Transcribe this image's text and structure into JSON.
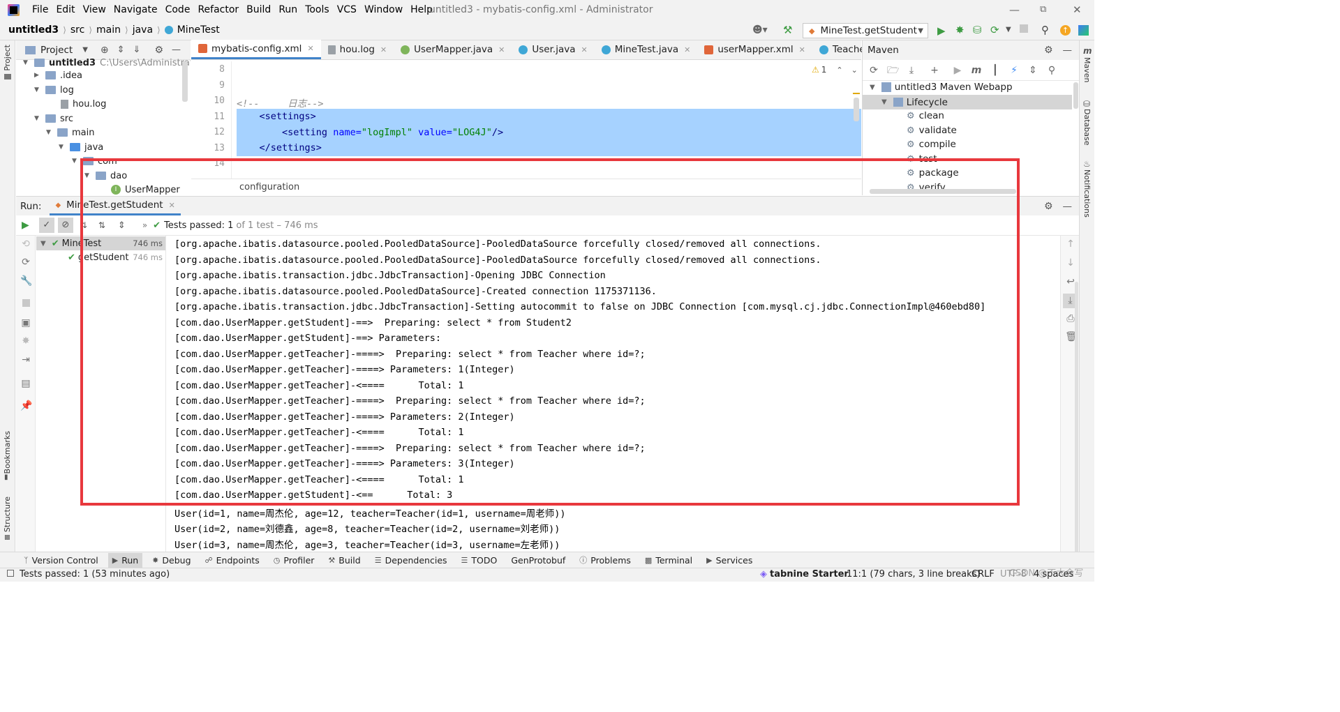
{
  "menu": {
    "items": [
      "File",
      "Edit",
      "View",
      "Navigate",
      "Code",
      "Refactor",
      "Build",
      "Run",
      "Tools",
      "VCS",
      "Window",
      "Help"
    ],
    "window_title": "untitled3 - mybatis-config.xml - Administrator"
  },
  "navbar": {
    "crumbs": [
      "untitled3",
      "src",
      "main",
      "java",
      "MineTest"
    ],
    "run_config": "MineTest.getStudent"
  },
  "left_stripe": {
    "project": "Project",
    "bookmarks": "Bookmarks",
    "structure": "Structure"
  },
  "right_stripe": {
    "maven": "Maven",
    "database": "Database",
    "notifications": "Notifications"
  },
  "project_panel": {
    "title": "Project",
    "root_name": "untitled3",
    "root_path": "C:\\Users\\Administrator\\",
    "items": [
      {
        "label": ".idea"
      },
      {
        "label": "log"
      },
      {
        "label": "hou.log"
      },
      {
        "label": "src"
      },
      {
        "label": "main"
      },
      {
        "label": "java"
      },
      {
        "label": "com"
      },
      {
        "label": "dao"
      },
      {
        "label": "UserMapper"
      }
    ]
  },
  "editor": {
    "tabs": [
      {
        "label": "mybatis-config.xml",
        "color": "#e0663a"
      },
      {
        "label": "hou.log",
        "color": "#9aa0a6"
      },
      {
        "label": "UserMapper.java",
        "color": "#7fb55b"
      },
      {
        "label": "User.java",
        "color": "#3fa7d6"
      },
      {
        "label": "MineTest.java",
        "color": "#3fa7d6"
      },
      {
        "label": "userMapper.xml",
        "color": "#e0663a"
      },
      {
        "label": "Teacher.java",
        "color": "#3fa7d6"
      }
    ],
    "line_numbers": [
      "8",
      "9",
      "10",
      "11",
      "12",
      "13",
      "14"
    ],
    "comment": "<!--     日志-->",
    "settings_open": "<settings>",
    "setting_tag": "<setting",
    "setting_name_attr": "name=",
    "setting_name_val": "\"logImpl\"",
    "setting_value_attr": "value=",
    "setting_value_val": "\"LOG4J\"",
    "setting_close": "/>",
    "settings_close": "</settings>",
    "warning_count": "1",
    "breadcrumb": "configuration"
  },
  "maven": {
    "title": "Maven",
    "project": "untitled3 Maven Webapp",
    "lifecycle": "Lifecycle",
    "phases": [
      "clean",
      "validate",
      "compile",
      "test",
      "package",
      "verify"
    ]
  },
  "run": {
    "label": "Run:",
    "tab": "MineTest.getStudent",
    "status_bold": "Tests passed: 1",
    "status_rest": "of 1 test – 746 ms",
    "tree": [
      {
        "name": "MineTest",
        "time": "746 ms"
      },
      {
        "name": "getStudent",
        "time": "746 ms"
      }
    ],
    "console": [
      "[org.apache.ibatis.datasource.pooled.PooledDataSource]-PooledDataSource forcefully closed/removed all connections.",
      "[org.apache.ibatis.datasource.pooled.PooledDataSource]-PooledDataSource forcefully closed/removed all connections.",
      "[org.apache.ibatis.transaction.jdbc.JdbcTransaction]-Opening JDBC Connection",
      "[org.apache.ibatis.datasource.pooled.PooledDataSource]-Created connection 1175371136.",
      "[org.apache.ibatis.transaction.jdbc.JdbcTransaction]-Setting autocommit to false on JDBC Connection [com.mysql.cj.jdbc.ConnectionImpl@460ebd80]",
      "[com.dao.UserMapper.getStudent]-==>  Preparing: select * from Student2",
      "[com.dao.UserMapper.getStudent]-==> Parameters: ",
      "[com.dao.UserMapper.getTeacher]-====>  Preparing: select * from Teacher where id=?;",
      "[com.dao.UserMapper.getTeacher]-====> Parameters: 1(Integer)",
      "[com.dao.UserMapper.getTeacher]-<====      Total: 1",
      "[com.dao.UserMapper.getTeacher]-====>  Preparing: select * from Teacher where id=?;",
      "[com.dao.UserMapper.getTeacher]-====> Parameters: 2(Integer)",
      "[com.dao.UserMapper.getTeacher]-<====      Total: 1",
      "[com.dao.UserMapper.getTeacher]-====>  Preparing: select * from Teacher where id=?;",
      "[com.dao.UserMapper.getTeacher]-====> Parameters: 3(Integer)",
      "[com.dao.UserMapper.getTeacher]-<====      Total: 1",
      "[com.dao.UserMapper.getStudent]-<==      Total: 3",
      "User(id=1, name=周杰伦, age=12, teacher=Teacher(id=1, username=周老师))",
      "User(id=2, name=刘德鑫, age=8, teacher=Teacher(id=2, username=刘老师))",
      "User(id=3, name=周杰伦, age=3, teacher=Teacher(id=3, username=左老师))"
    ]
  },
  "bottom_tools": [
    "Version Control",
    "Run",
    "Debug",
    "Endpoints",
    "Profiler",
    "Build",
    "Dependencies",
    "TODO",
    "GenProtobuf",
    "Problems",
    "Terminal",
    "Services"
  ],
  "status": {
    "message": "Tests passed: 1 (53 minutes ago)",
    "tabnine": "tabnine Starter",
    "position": "11:1 (79 chars, 3 line breaks)",
    "line_sep": "CRLF",
    "encoding": "UTF-8",
    "indent": "4 spaces",
    "watermark": "CSDN @不大会写"
  }
}
